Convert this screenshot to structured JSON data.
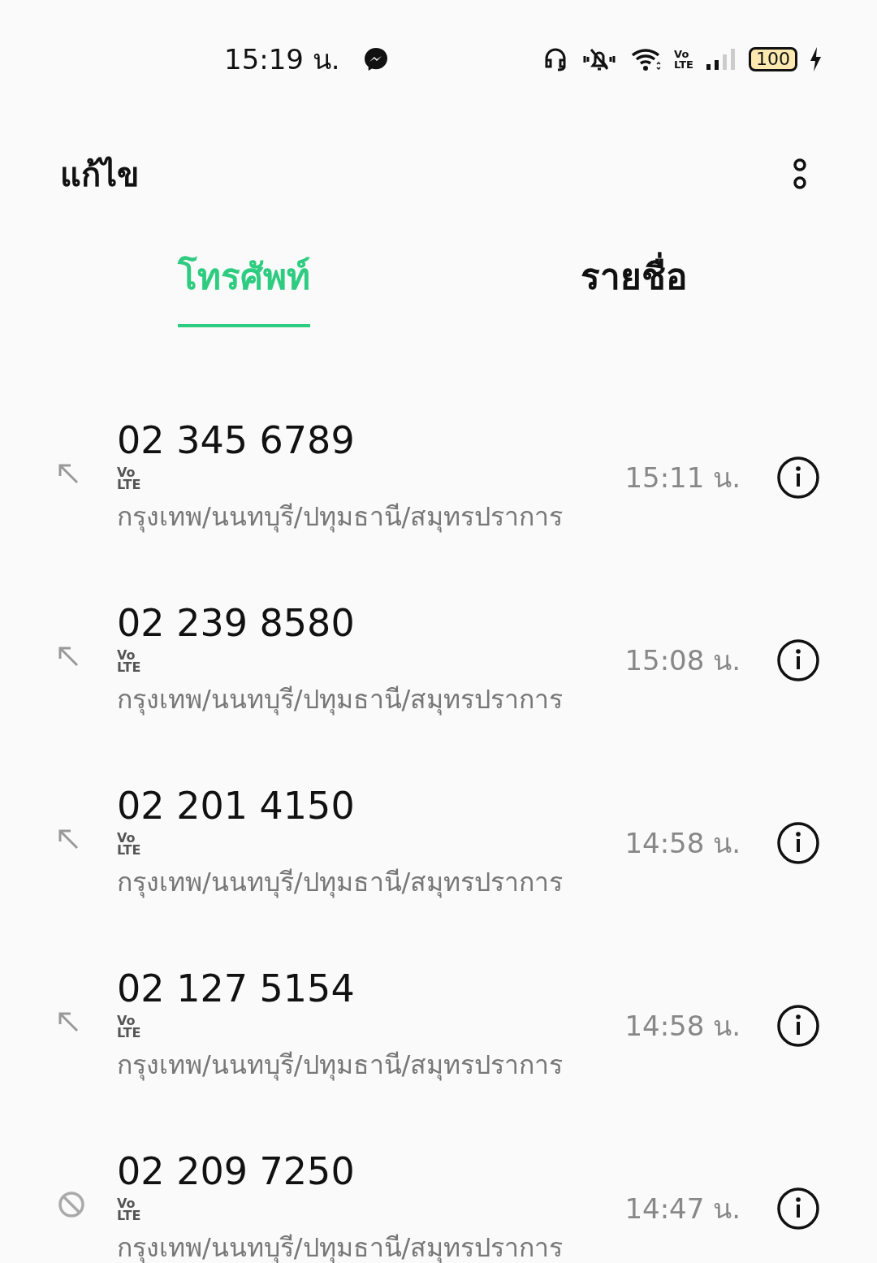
{
  "status_bar": {
    "time": "15:19 น.",
    "volte": [
      "Vo",
      "LTE"
    ],
    "battery": "100"
  },
  "header": {
    "title": "แก้ไข"
  },
  "tabs": [
    {
      "label": "โทรศัพท์",
      "selected": true
    },
    {
      "label": "รายชื่อ",
      "selected": false
    }
  ],
  "calls": [
    {
      "kind": "outgoing",
      "number": "02 345 6789",
      "volte": [
        "Vo",
        "LTE"
      ],
      "location": "กรุงเทพ/นนทบุรี/ปทุมธานี/สมุทรปราการ",
      "time": "15:11 น."
    },
    {
      "kind": "outgoing",
      "number": "02 239 8580",
      "volte": [
        "Vo",
        "LTE"
      ],
      "location": "กรุงเทพ/นนทบุรี/ปทุมธานี/สมุทรปราการ",
      "time": "15:08 น."
    },
    {
      "kind": "outgoing",
      "number": "02 201 4150",
      "volte": [
        "Vo",
        "LTE"
      ],
      "location": "กรุงเทพ/นนทบุรี/ปทุมธานี/สมุทรปราการ",
      "time": "14:58 น."
    },
    {
      "kind": "outgoing",
      "number": "02 127 5154",
      "volte": [
        "Vo",
        "LTE"
      ],
      "location": "กรุงเทพ/นนทบุรี/ปทุมธานี/สมุทรปราการ",
      "time": "14:58 น."
    },
    {
      "kind": "blocked",
      "number": "02 209 7250",
      "volte": [
        "Vo",
        "LTE"
      ],
      "location": "กรุงเทพ/นนทบุรี/ปทุมธานี/สมุทรปราการ",
      "time": "14:47 น."
    }
  ]
}
